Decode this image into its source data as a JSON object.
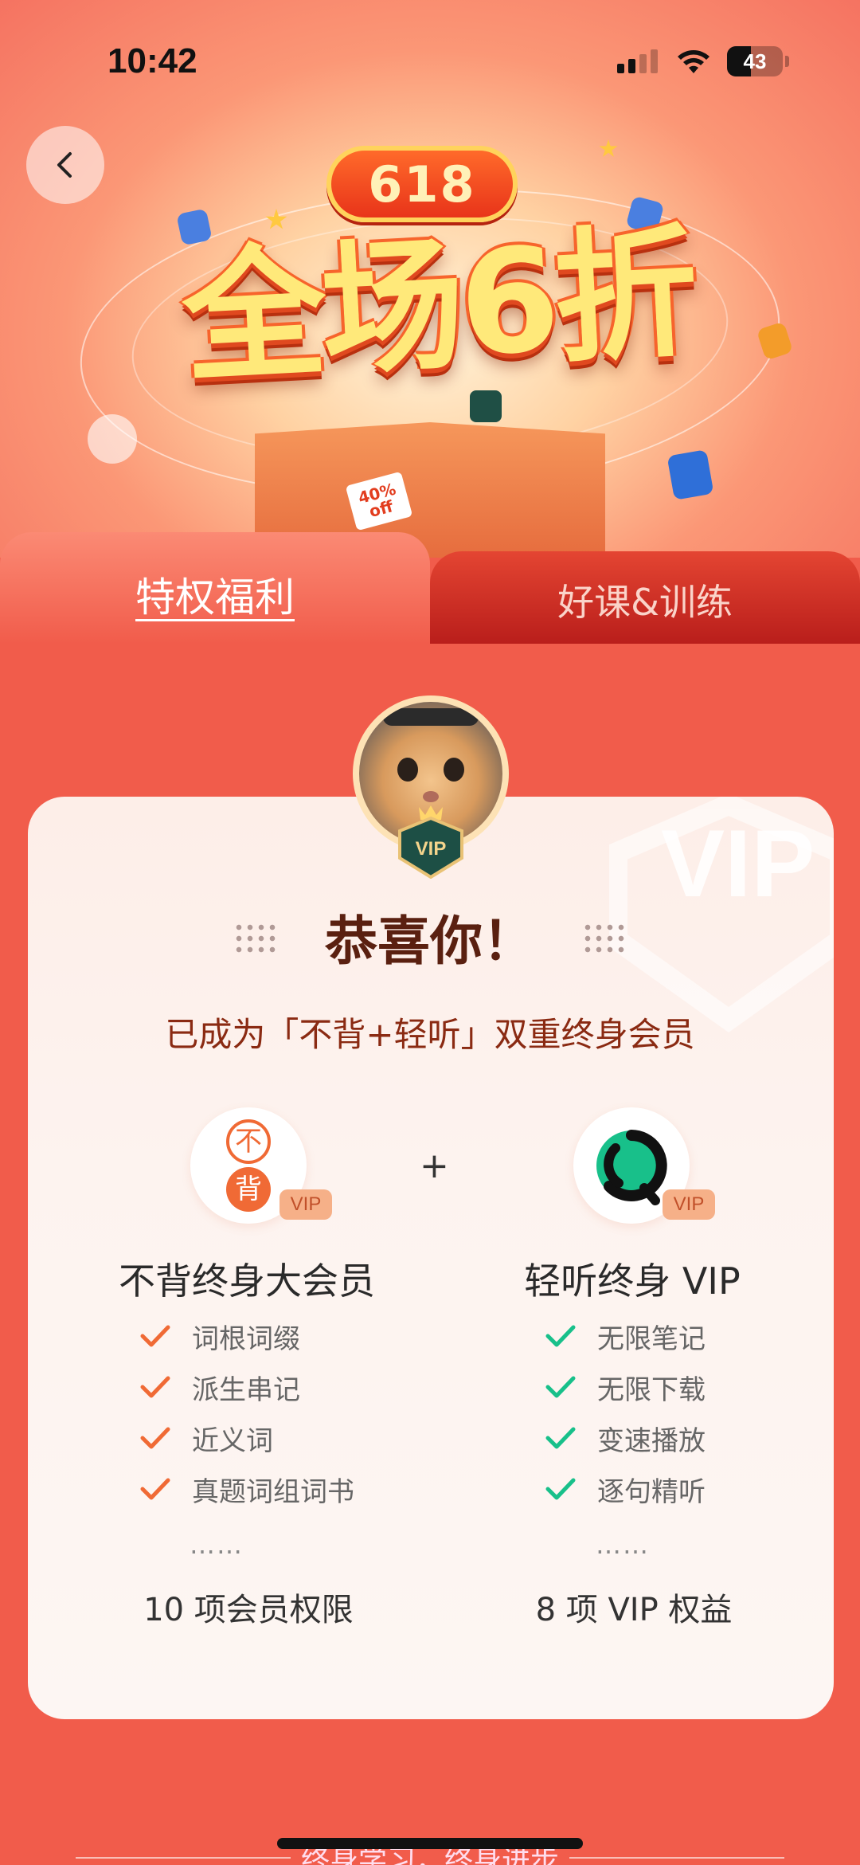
{
  "status_bar": {
    "time": "10:42",
    "battery_level": "43",
    "battery_fraction": 0.43
  },
  "banner": {
    "badge": "618",
    "headline": "全场6折",
    "box_tag": "40%\noff"
  },
  "tabs": [
    {
      "label": "特权福利",
      "active": true
    },
    {
      "label": "好课&训练",
      "active": false
    }
  ],
  "card": {
    "bg_watermark": "VIP",
    "avatar_badge": "VIP",
    "congrats": "恭喜你！",
    "subtitle": "已成为「不背+轻听」双重终身会员",
    "plus": "+",
    "left": {
      "logo_text_top": "不",
      "logo_text_bottom": "背",
      "vip_tag": "VIP",
      "title": "不背终身大会员",
      "benefits": [
        "词根词缀",
        "派生串记",
        "近义词",
        "真题词组词书"
      ],
      "ellipsis": "……",
      "count": "10 项会员权限",
      "check_color": "#f06a35"
    },
    "right": {
      "vip_tag": "VIP",
      "title": "轻听终身 VIP",
      "benefits": [
        "无限笔记",
        "无限下载",
        "变速播放",
        "逐句精听"
      ],
      "ellipsis": "……",
      "count": "8 项 VIP 权益",
      "check_color": "#18c08a"
    }
  },
  "footer": {
    "text": "终身学习，终身进步"
  },
  "colors": {
    "page_bg": "#f15c4b",
    "accent_orange": "#f06a35",
    "accent_green": "#18c08a"
  }
}
